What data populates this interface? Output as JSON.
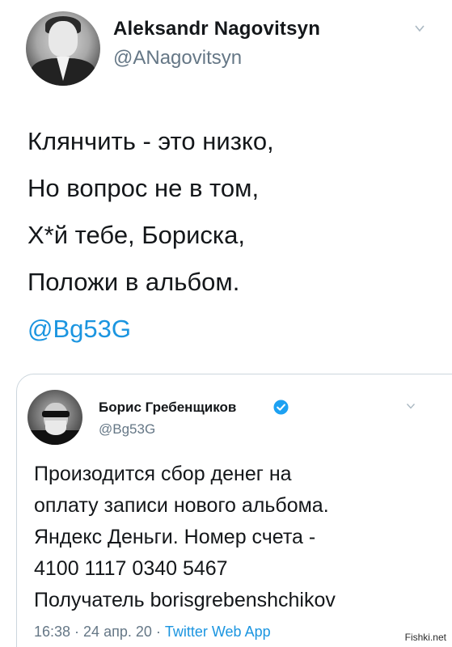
{
  "tweet": {
    "author_name": "Aleksandr Nagovitsyn",
    "author_handle": "@ANagovitsyn",
    "lines": [
      "Клянчить - это низко,",
      "Но вопрос не в том,",
      "Х*й тебе, Бориска,",
      "Положи в альбом."
    ],
    "mention": "@Bg53G"
  },
  "quoted_tweet": {
    "author_name": "Борис Гребенщиков",
    "author_handle": "@Bg53G",
    "lines": [
      "Произодится сбор денег на",
      "оплату записи нового альбома.",
      "Яндекс Деньги. Номер счета -",
      "4100 1117 0340 5467",
      "Получатель borisgrebenshchikov"
    ],
    "time": "16:38",
    "date": "24 апр. 20",
    "app": "Twitter Web App",
    "separator": "·"
  },
  "watermark": "Fishki.net",
  "icons": {
    "menu": "chevron-down-icon",
    "verified": "verified-badge-icon"
  },
  "colors": {
    "link": "#1b95e0",
    "muted": "#657786",
    "text": "#14171a",
    "border": "#ccd6dd"
  }
}
